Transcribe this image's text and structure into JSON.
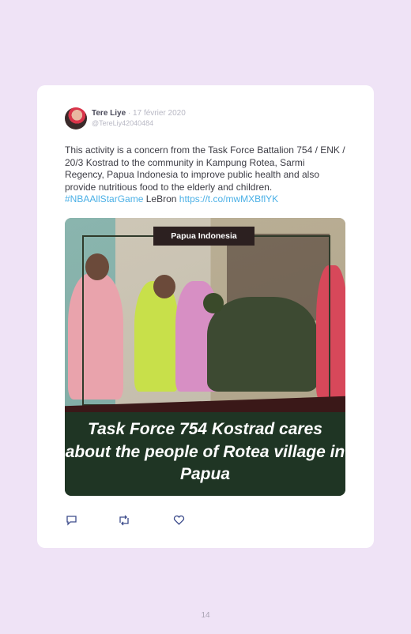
{
  "tweet": {
    "name": "Tere Liye",
    "date": "· 17 février 2020",
    "handle": "@TereLiy42040484",
    "text_main": "This activity is a concern from the Task Force Battalion 754 / ENK / 20/3 Kostrad to the community in Kampung Rotea, Sarmi Regency, Papua Indonesia to improve public health and also provide nutritious food to the elderly and children.",
    "hashtag": "#NBAAllStarGame",
    "text_mid": "LeBron",
    "url": "https://t.co/mwMXBflYK"
  },
  "media": {
    "tag_label": "Papua Indonesia",
    "caption": "Task Force 754 Kostrad cares about the people of Rotea village in Papua"
  },
  "actions": {
    "reply_icon": "reply-icon",
    "retweet_icon": "retweet-icon",
    "like_icon": "heart-icon"
  },
  "page": {
    "number": "14"
  },
  "colors": {
    "background": "#efe3f6",
    "card": "#ffffff",
    "link": "#4bb0e6",
    "caption_band": "#1f3524"
  }
}
